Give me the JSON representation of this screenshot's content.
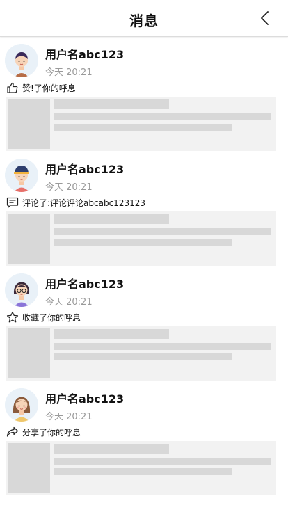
{
  "header": {
    "title": "消息"
  },
  "messages": [
    {
      "username": "用户名abc123",
      "time": "今天 20:21",
      "action_text": "赞!了你的呼息",
      "icon": "thumb-up-icon"
    },
    {
      "username": "用户名abc123",
      "time": "今天 20:21",
      "action_text": "评论了:评论评论abcabc123123",
      "icon": "comment-icon"
    },
    {
      "username": "用户名abc123",
      "time": "今天 20:21",
      "action_text": "收藏了你的呼息",
      "icon": "star-icon"
    },
    {
      "username": "用户名abc123",
      "time": "今天 20:21",
      "action_text": "分享了你的呼息",
      "icon": "share-icon"
    }
  ]
}
